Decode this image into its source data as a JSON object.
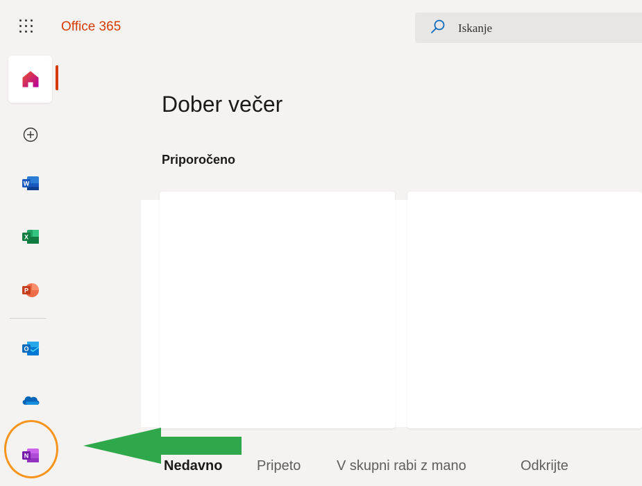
{
  "header": {
    "brand": "Office 365",
    "search": {
      "placeholder": "Iskanje",
      "value": ""
    }
  },
  "rail": {
    "items": [
      {
        "name": "home",
        "icon": "home-icon",
        "color": "#d83b01",
        "active": true
      },
      {
        "name": "create",
        "icon": "plus-circle-icon"
      },
      {
        "name": "word",
        "icon": "word-icon",
        "letter": "W",
        "color": "#185abd"
      },
      {
        "name": "excel",
        "icon": "excel-icon",
        "letter": "X",
        "color": "#107c41"
      },
      {
        "name": "powerpoint",
        "icon": "powerpoint-icon",
        "letter": "P",
        "color": "#c43e1c"
      },
      {
        "name": "outlook",
        "icon": "outlook-icon",
        "letter": "O",
        "color": "#0f6cbd"
      },
      {
        "name": "onedrive",
        "icon": "onedrive-icon",
        "color": "#0364b8"
      },
      {
        "name": "onenote",
        "icon": "onenote-icon",
        "letter": "N",
        "color": "#7719aa"
      }
    ]
  },
  "main": {
    "greeting": "Dober večer",
    "recommended_title": "Priporočeno",
    "tabs": [
      {
        "label": "Nedavno",
        "active": true
      },
      {
        "label": "Pripeto",
        "active": false
      },
      {
        "label": "V skupni rabi z mano",
        "active": false
      },
      {
        "label": "Odkrijte",
        "active": false
      }
    ]
  },
  "annotations": {
    "circle_color": "#f7941d",
    "arrow_color": "#2ea84a"
  },
  "colors": {
    "accent": "#d83b01",
    "background": "#f4f3f2"
  }
}
